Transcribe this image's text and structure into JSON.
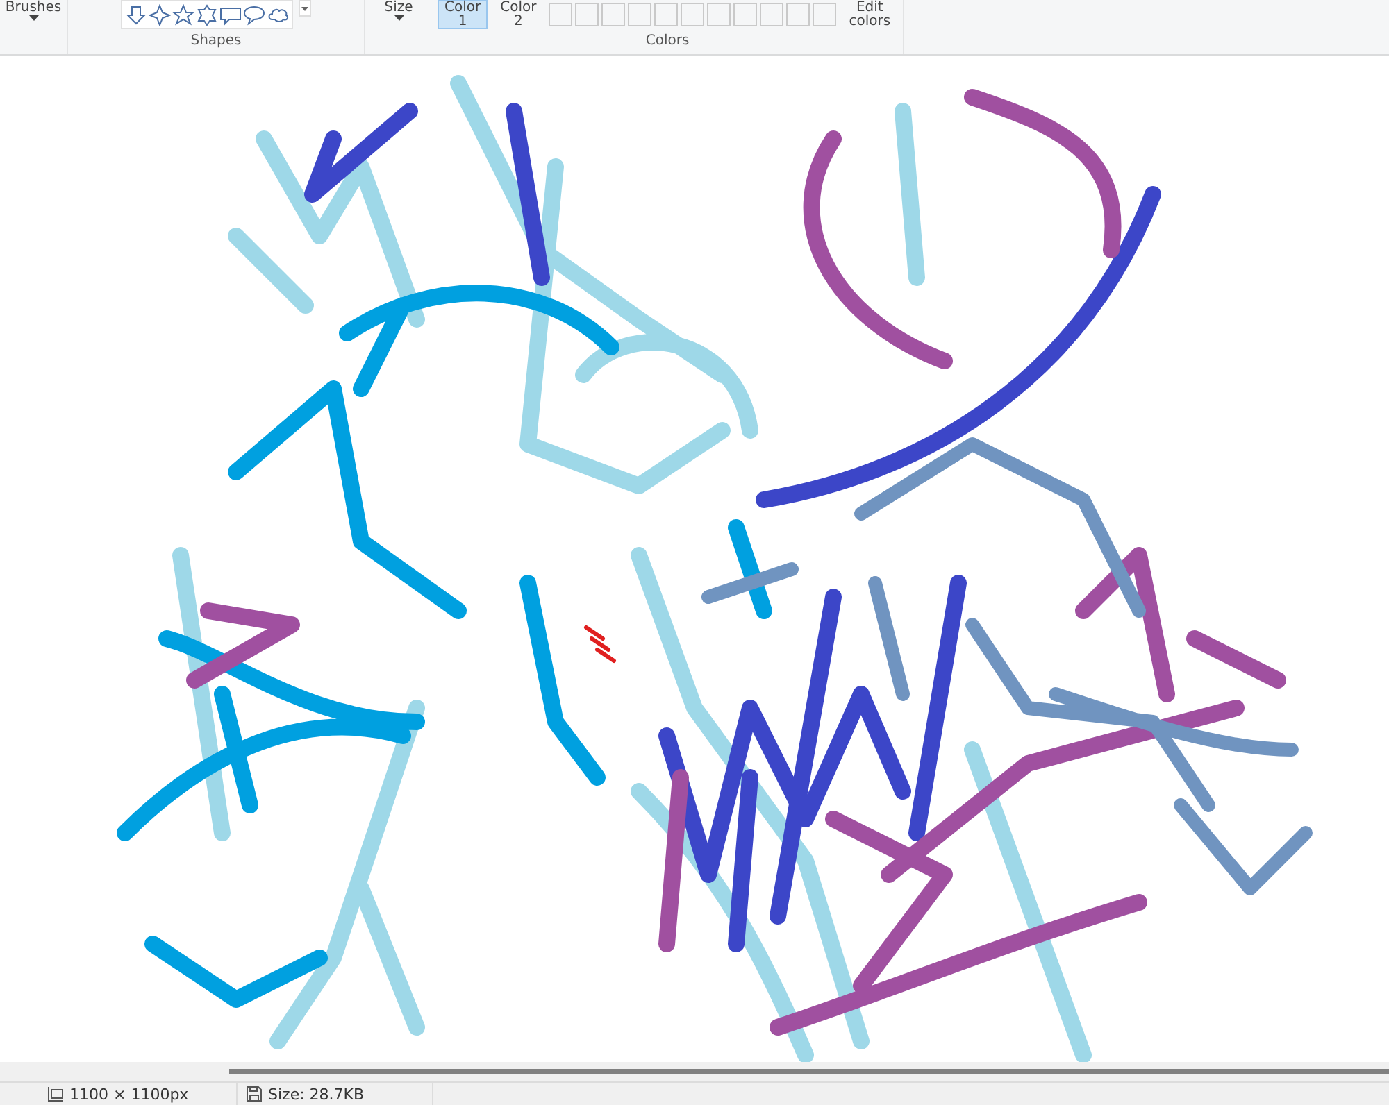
{
  "ribbon": {
    "brushes": {
      "label": "Brushes"
    },
    "shapes_group": {
      "label": "Shapes"
    },
    "size": {
      "label": "Size"
    },
    "color_slots": [
      {
        "line1": "Color",
        "line2": "1",
        "selected": true
      },
      {
        "line1": "Color",
        "line2": "2",
        "selected": false
      }
    ],
    "edit_colors": {
      "line1": "Edit",
      "line2": "colors"
    },
    "colors_group": {
      "label": "Colors"
    }
  },
  "status_bar": {
    "dimensions": "1100 × 1100px",
    "file_size": "Size: 28.7KB"
  }
}
